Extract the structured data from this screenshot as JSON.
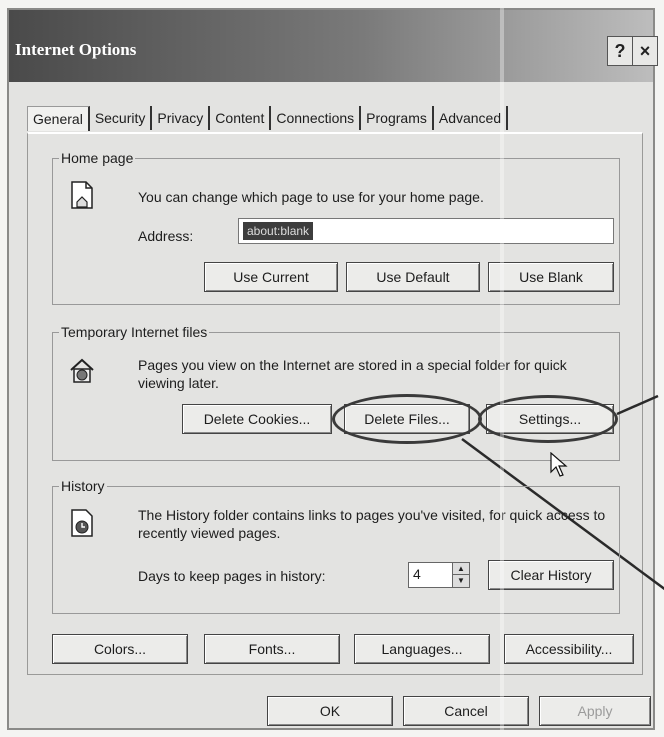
{
  "window": {
    "title": "Internet Options",
    "help_label": "?",
    "close_label": "×"
  },
  "tabs": [
    {
      "label": "General"
    },
    {
      "label": "Security"
    },
    {
      "label": "Privacy"
    },
    {
      "label": "Content"
    },
    {
      "label": "Connections"
    },
    {
      "label": "Programs"
    },
    {
      "label": "Advanced"
    }
  ],
  "home_page": {
    "legend": "Home page",
    "description": "You can change which page to use for your home page.",
    "address_label": "Address:",
    "address_value": "about:blank",
    "use_current": "Use Current",
    "use_default": "Use Default",
    "use_blank": "Use Blank"
  },
  "temp_files": {
    "legend": "Temporary Internet files",
    "description": "Pages you view on the Internet are stored in a special folder for quick viewing later.",
    "delete_cookies": "Delete Cookies...",
    "delete_files": "Delete Files...",
    "settings": "Settings..."
  },
  "history": {
    "legend": "History",
    "description": "The History folder contains links to pages you've visited, for quick access to recently viewed pages.",
    "days_label": "Days to keep pages in history:",
    "days_value": "4",
    "clear_history": "Clear History"
  },
  "bottom_buttons": {
    "colors": "Colors...",
    "fonts": "Fonts...",
    "languages": "Languages...",
    "accessibility": "Accessibility..."
  },
  "dialog_buttons": {
    "ok": "OK",
    "cancel": "Cancel",
    "apply": "Apply"
  },
  "icons": {
    "home_page": "page-icon",
    "temp_files": "globe-house-icon",
    "history": "history-clock-icon",
    "cursor": "mouse-pointer-icon",
    "spin_up": "spin-up-icon",
    "spin_down": "spin-down-icon"
  }
}
